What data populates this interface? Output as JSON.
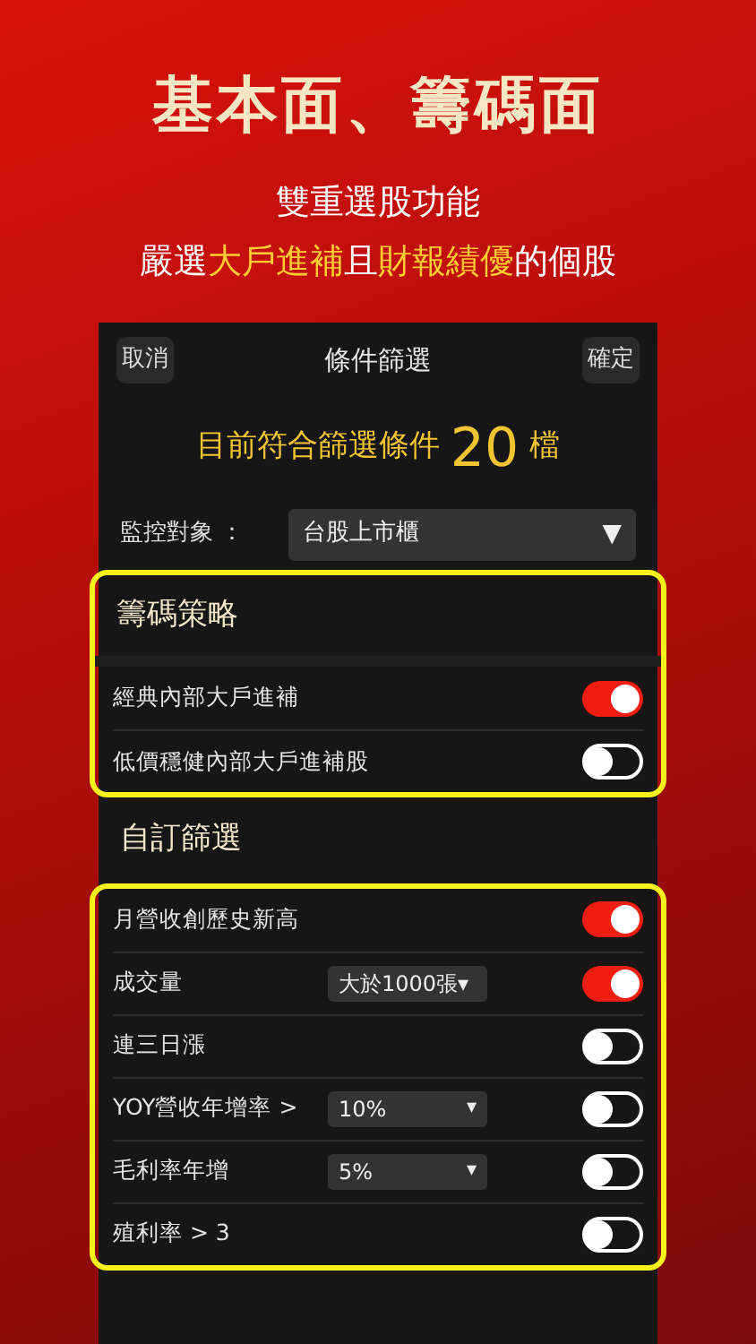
{
  "headline": {
    "title": "基本面、籌碼面",
    "line1": "雙重選股功能",
    "line2": [
      {
        "text": "嚴選",
        "highlight": false
      },
      {
        "text": "大戶進補",
        "highlight": true
      },
      {
        "text": "且",
        "highlight": false
      },
      {
        "text": "財報績優",
        "highlight": true
      },
      {
        "text": "的個股",
        "highlight": false
      }
    ]
  },
  "screen": {
    "cancel": "取消",
    "title": "條件篩選",
    "confirm": "確定",
    "count": {
      "prefix": "目前符合篩選條件",
      "number": "20",
      "suffix": "檔"
    },
    "monitor": {
      "label": "監控對象 ：",
      "value": "台股上市櫃",
      "arrow": "▼"
    },
    "sections": [
      {
        "title": "籌碼策略",
        "highlighted": true,
        "rows": [
          {
            "label": "經典內部大戶進補",
            "on": true
          },
          {
            "label": "低價穩健內部大戶進補股",
            "on": false
          }
        ]
      },
      {
        "title": "自訂篩選",
        "highlighted": true,
        "rows": [
          {
            "label": "月營收創歷史新高",
            "on": true
          },
          {
            "label": "成交量",
            "dropdown": "大於1000張▾",
            "on": true
          },
          {
            "label": "連三日漲",
            "on": false
          },
          {
            "label": "YOY營收年增率 >",
            "dropdown": "10%",
            "arrow": "▾",
            "on": false
          },
          {
            "label": "毛利率年增",
            "dropdown": "5%",
            "arrow": "▾",
            "on": false
          },
          {
            "label": "殖利率 > 3",
            "on": false
          }
        ]
      }
    ]
  }
}
